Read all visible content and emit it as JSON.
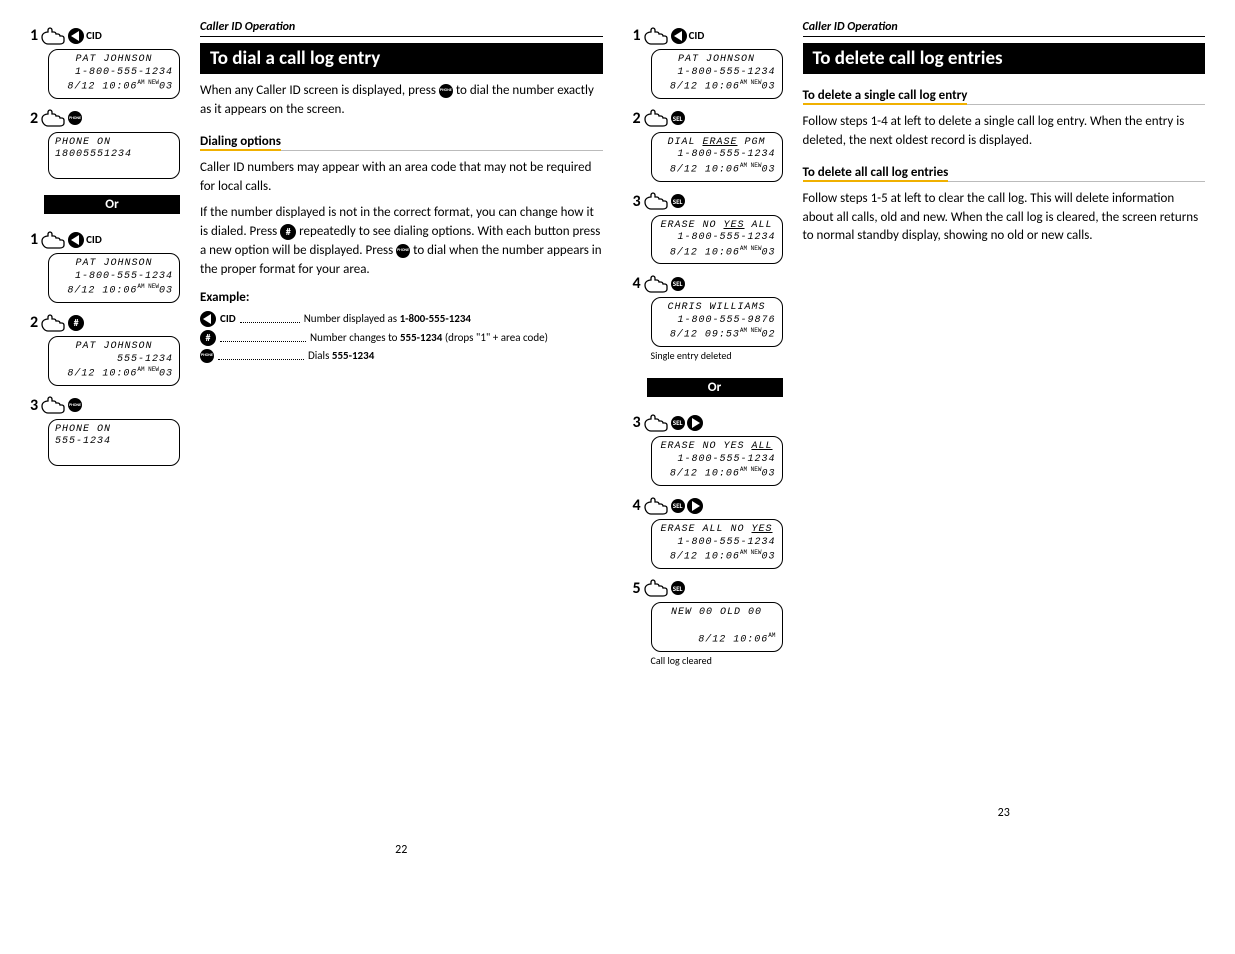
{
  "left": {
    "breadcrumb": "Caller ID Operation",
    "title": "To dial a call log entry",
    "intro_a": "When any Caller ID screen is displayed, press ",
    "intro_b": " to dial the number exactly as it appears on the screen.",
    "sub1": "Dialing options",
    "p2": "Caller ID numbers may appear with an area code that may not be required for local calls.",
    "p3a": "If the number displayed is not in the correct format, you can change how it is dialed. Press ",
    "p3b": " repeatedly to see dialing options. With each button press a new option will be displayed. Press ",
    "p3c": " to dial when the number appears in the proper format for your area.",
    "example_label": "Example:",
    "ex1": "Number displayed as ",
    "ex1b": "1-800-555-1234",
    "ex2": "Number changes to ",
    "ex2b": "555-1234",
    "ex2c": " (drops \"1\" + area code)",
    "ex3": "Dials ",
    "ex3b": "555-1234",
    "cid": "CID",
    "pageNum": "22",
    "sidebar": {
      "s1": {
        "l1": "PAT JOHNSON",
        "l2": "1-800-555-1234",
        "l3": "8/12 10:06",
        "sup": "AM NEW",
        "suf": "03"
      },
      "s2": {
        "l1": "PHONE ON",
        "l2": "18005551234"
      },
      "or": "Or",
      "s3": {
        "l1": "PAT JOHNSON",
        "l2": "1-800-555-1234",
        "l3": "8/12 10:06",
        "sup": "AM NEW",
        "suf": "03"
      },
      "s4": {
        "l1": "PAT JOHNSON",
        "l2": "555-1234",
        "l3": "8/12 10:06",
        "sup": "AM NEW",
        "suf": "03"
      },
      "s5": {
        "l1": "PHONE ON",
        "l2": "555-1234"
      }
    }
  },
  "right": {
    "breadcrumb": "Caller ID Operation",
    "title": "To delete call log entries",
    "sub1": "To delete a single call log entry",
    "p1": "Follow steps 1-4 at left to delete a single call log entry. When the entry is deleted, the next oldest record is displayed.",
    "sub2": "To delete all call log entries",
    "p2": "Follow steps 1-5 at left to clear the call log. This will delete information about all calls, old and new. When the call log is cleared, the screen returns to normal standby display, showing no old or new calls.",
    "pageNum": "23",
    "sidebar": {
      "s1": {
        "l1": "PAT JOHNSON",
        "l2": "1-800-555-1234",
        "l3": "8/12 10:06",
        "sup": "AM NEW",
        "suf": "03"
      },
      "s2": {
        "l1a": "DIAL ",
        "l1u": "ERASE",
        "l1b": " PGM",
        "l2": "1-800-555-1234",
        "l3": "8/12 10:06",
        "sup": "AM NEW",
        "suf": "03"
      },
      "s3": {
        "l1a": "ERASE NO ",
        "l1u": "YES",
        "l1b": " ALL",
        "l2": "1-800-555-1234",
        "l3": "8/12 10:06",
        "sup": "AM NEW",
        "suf": "03"
      },
      "s4": {
        "l1": "CHRIS WILLIAMS",
        "l2": "1-800-555-9876",
        "l3": "8/12 09:53",
        "sup": "AM NEW",
        "suf": "02"
      },
      "cap4": "Single entry deleted",
      "or": "Or",
      "s5": {
        "l1a": "ERASE NO YES ",
        "l1u": "ALL",
        "l1b": "",
        "l2": "1-800-555-1234",
        "l3": "8/12 10:06",
        "sup": "AM NEW",
        "suf": "03"
      },
      "s6": {
        "l1a": "ERASE ALL NO ",
        "l1u": "YES",
        "l1b": "",
        "l2": "1-800-555-1234",
        "l3": "8/12 10:06",
        "sup": "AM NEW",
        "suf": "03"
      },
      "s7": {
        "l1": "NEW 00  OLD 00",
        "l2": "",
        "l3": "8/12  10:06",
        "sup": "AM",
        "suf": ""
      },
      "cap7": "Call log cleared"
    }
  },
  "labels": {
    "sel": "SEL",
    "phone": "PHONE",
    "hash": "#"
  }
}
